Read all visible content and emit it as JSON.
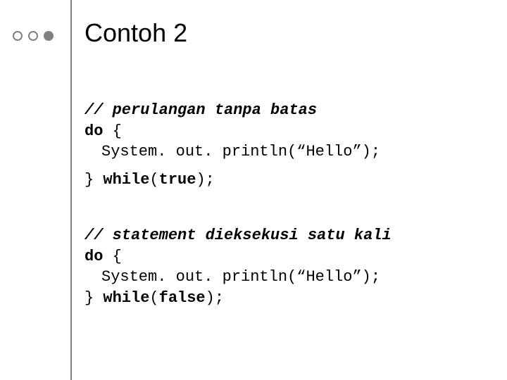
{
  "title": "Contoh 2",
  "block1": {
    "comment": "// perulangan tanpa batas",
    "line1a": "do",
    "line1b": " {",
    "line2a": "System. out. println(",
    "line2b": "“Hello”",
    "line2c": ");",
    "line3a": "} ",
    "line3b": "while",
    "line3c": "(",
    "line3d": "true",
    "line3e": ");"
  },
  "block2": {
    "comment": "// statement dieksekusi satu kali",
    "line1a": "do",
    "line1b": " {",
    "line2a": "System. out. println(",
    "line2b": "“Hello”",
    "line2c": ");",
    "line3a": "} ",
    "line3b": "while",
    "line3c": "(",
    "line3d": "false",
    "line3e": ");"
  }
}
